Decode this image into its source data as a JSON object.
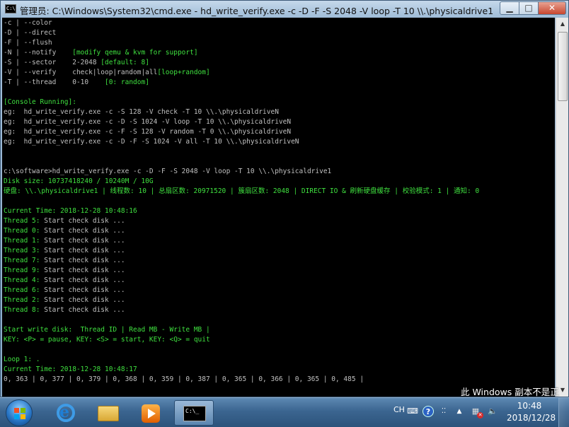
{
  "window": {
    "title": "管理员: C:\\Windows\\System32\\cmd.exe - hd_write_verify.exe  -c -D -F -S 2048 -V loop -T 10 \\\\.\\physicaldrive1",
    "icon_text": "C:\\",
    "controls": {
      "minimize": "▁",
      "maximize": "□",
      "close": "✕"
    }
  },
  "console": {
    "lines": [
      {
        "c": "w",
        "t": "-c | --color"
      },
      {
        "c": "w",
        "t": "-D | --direct"
      },
      {
        "c": "w",
        "t": "-F | --flush"
      },
      {
        "c": "mix",
        "t": "-N | --notify    ",
        "g": "[modify qemu & kvm for support]"
      },
      {
        "c": "mix",
        "t": "-S | --sector    2-2048 ",
        "g": "[default: 8]"
      },
      {
        "c": "mix",
        "t": "-V | --verify    check|loop|random|all",
        "g": "[loop+random]"
      },
      {
        "c": "mix",
        "t": "-T | --thread    0-10    ",
        "g": "[0: random]"
      },
      {
        "c": "w",
        "t": ""
      },
      {
        "c": "g",
        "t": "[Console Running]:"
      },
      {
        "c": "w",
        "t": "eg:  hd_write_verify.exe -c -S 128 -V check -T 10 \\\\.\\physicaldriveN"
      },
      {
        "c": "w",
        "t": "eg:  hd_write_verify.exe -c -D -S 1024 -V loop -T 10 \\\\.\\physicaldriveN"
      },
      {
        "c": "w",
        "t": "eg:  hd_write_verify.exe -c -F -S 128 -V random -T 0 \\\\.\\physicaldriveN"
      },
      {
        "c": "w",
        "t": "eg:  hd_write_verify.exe -c -D -F -S 1024 -V all -T 10 \\\\.\\physicaldriveN"
      },
      {
        "c": "w",
        "t": ""
      },
      {
        "c": "w",
        "t": ""
      },
      {
        "c": "w",
        "t": "c:\\software>hd_write_verify.exe -c -D -F -S 2048 -V loop -T 10 \\\\.\\physicaldrive1"
      },
      {
        "c": "g",
        "t": "Disk size: 10737418240 / 10240M / 10G"
      },
      {
        "c": "g",
        "t": "硬盘: \\\\.\\physicaldrive1 | 线程数: 10 | 总扇区数: 20971520 | 簇扇区数: 2048 | DIRECT IO & 刷新硬盘缓存 | 校验模式: 1 | 通知: 0"
      },
      {
        "c": "w",
        "t": ""
      },
      {
        "c": "g",
        "t": "Current Time: 2018-12-28 10:48:16"
      },
      {
        "c": "mix2",
        "g": "Thread 5:",
        "t": " Start check disk ..."
      },
      {
        "c": "mix2",
        "g": "Thread 0:",
        "t": " Start check disk ..."
      },
      {
        "c": "mix2",
        "g": "Thread 1:",
        "t": " Start check disk ..."
      },
      {
        "c": "mix2",
        "g": "Thread 3:",
        "t": " Start check disk ..."
      },
      {
        "c": "mix2",
        "g": "Thread 7:",
        "t": " Start check disk ..."
      },
      {
        "c": "mix2",
        "g": "Thread 9:",
        "t": " Start check disk ..."
      },
      {
        "c": "mix2",
        "g": "Thread 4:",
        "t": " Start check disk ..."
      },
      {
        "c": "mix2",
        "g": "Thread 6:",
        "t": " Start check disk ..."
      },
      {
        "c": "mix2",
        "g": "Thread 2:",
        "t": " Start check disk ..."
      },
      {
        "c": "mix2",
        "g": "Thread 8:",
        "t": " Start check disk ..."
      },
      {
        "c": "w",
        "t": ""
      },
      {
        "c": "g",
        "t": "Start write disk:  Thread ID | Read MB - Write MB |"
      },
      {
        "c": "g",
        "t": "KEY: <P> = pause, KEY: <S> = start, KEY: <Q> = quit"
      },
      {
        "c": "w",
        "t": ""
      },
      {
        "c": "g",
        "t": "Loop 1: ."
      },
      {
        "c": "g",
        "t": "Current Time: 2018-12-28 10:48:17"
      },
      {
        "c": "w",
        "t": "0, 363 | 0, 377 | 0, 379 | 0, 368 | 0, 359 | 0, 387 | 0, 365 | 0, 366 | 0, 365 | 0, 485 |"
      }
    ]
  },
  "watermark": "此 Windows 副本不是正",
  "taskbar": {
    "lang": "CH",
    "ime": "⁚⁚",
    "time": "10:48",
    "date": "2018/12/28",
    "cmd_icon_text": "C:\\_"
  },
  "colors": {
    "console_bg": "#000000",
    "text": "#c0c0c0",
    "green": "#3fe03f"
  }
}
